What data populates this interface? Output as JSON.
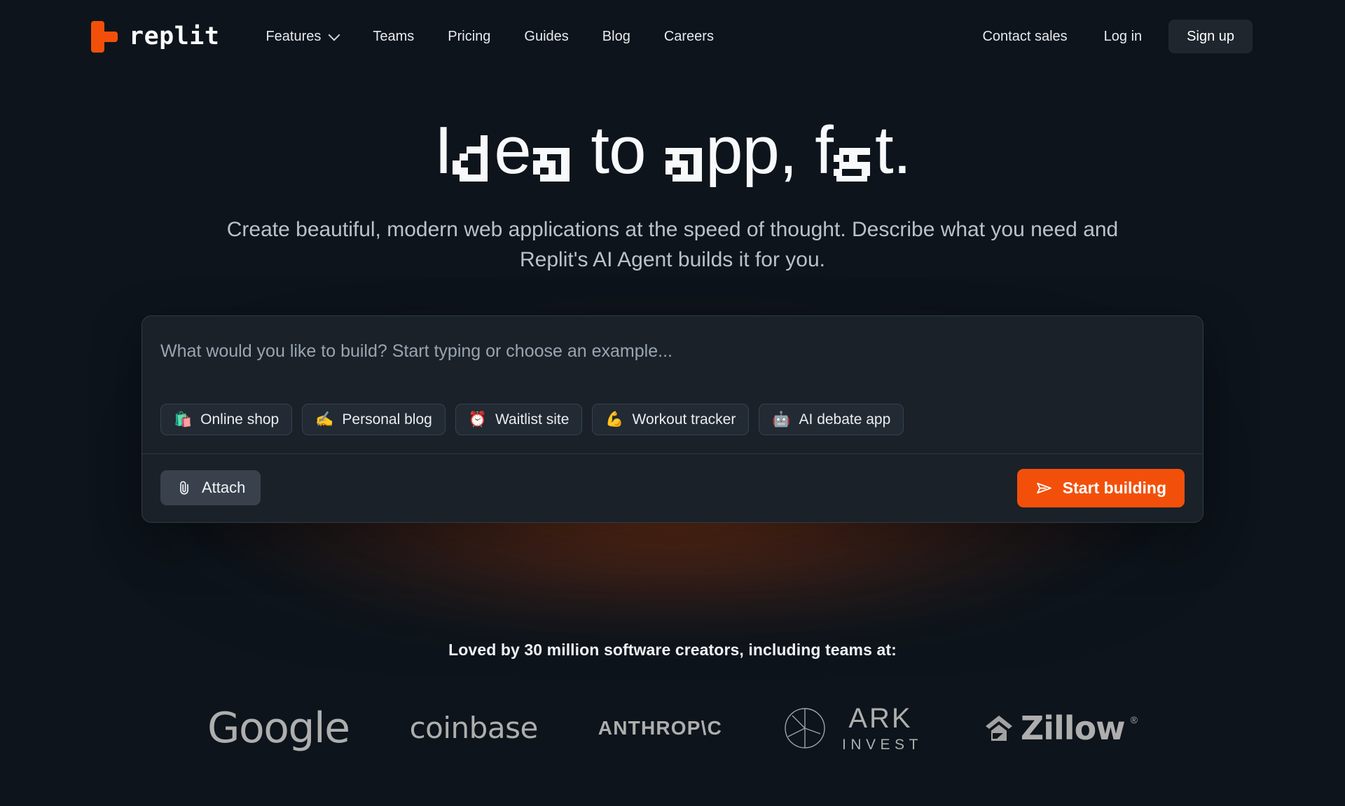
{
  "brand": {
    "name": "replit",
    "logo_icon": "replit-logo-icon",
    "accent_color": "#f2500a"
  },
  "nav": {
    "links": [
      {
        "label": "Features",
        "has_dropdown": true,
        "icon": "chevron-down-icon"
      },
      {
        "label": "Teams",
        "has_dropdown": false
      },
      {
        "label": "Pricing",
        "has_dropdown": false
      },
      {
        "label": "Guides",
        "has_dropdown": false
      },
      {
        "label": "Blog",
        "has_dropdown": false
      },
      {
        "label": "Careers",
        "has_dropdown": false
      }
    ],
    "contact_sales": "Contact sales",
    "log_in": "Log in",
    "sign_up": "Sign up"
  },
  "hero": {
    "headline_full": "Idea to app, fast.",
    "headline_parts": {
      "p1": "I",
      "p2": "e",
      "p3": " to ",
      "p4": "pp, f",
      "p5": "t."
    },
    "subtitle": "Create beautiful, modern web applications at the speed of thought. Describe what you need and Replit's AI Agent builds it for you."
  },
  "prompt": {
    "placeholder": "What would you like to build? Start typing or choose an example...",
    "value": "",
    "examples": [
      {
        "emoji": "🛍️",
        "icon": "shopping-bags-icon",
        "label": "Online shop"
      },
      {
        "emoji": "✍️",
        "icon": "writing-hand-icon",
        "label": "Personal blog"
      },
      {
        "emoji": "⏰",
        "icon": "alarm-clock-icon",
        "label": "Waitlist site"
      },
      {
        "emoji": "💪",
        "icon": "flexed-biceps-icon",
        "label": "Workout tracker"
      },
      {
        "emoji": "🤖",
        "icon": "robot-icon",
        "label": "AI debate app"
      }
    ],
    "attach_label": "Attach",
    "attach_icon": "paperclip-icon",
    "submit_label": "Start building",
    "submit_icon": "send-icon",
    "submit_color": "#f2500a"
  },
  "social_proof": {
    "title": "Loved by 30 million software creators, including teams at:",
    "logos": [
      {
        "name": "Google"
      },
      {
        "name": "coinbase"
      },
      {
        "name": "ANTHROP\\C"
      },
      {
        "name": "ARK",
        "sub": "INVEST"
      },
      {
        "name": "Zillow",
        "mark": "®"
      }
    ]
  }
}
